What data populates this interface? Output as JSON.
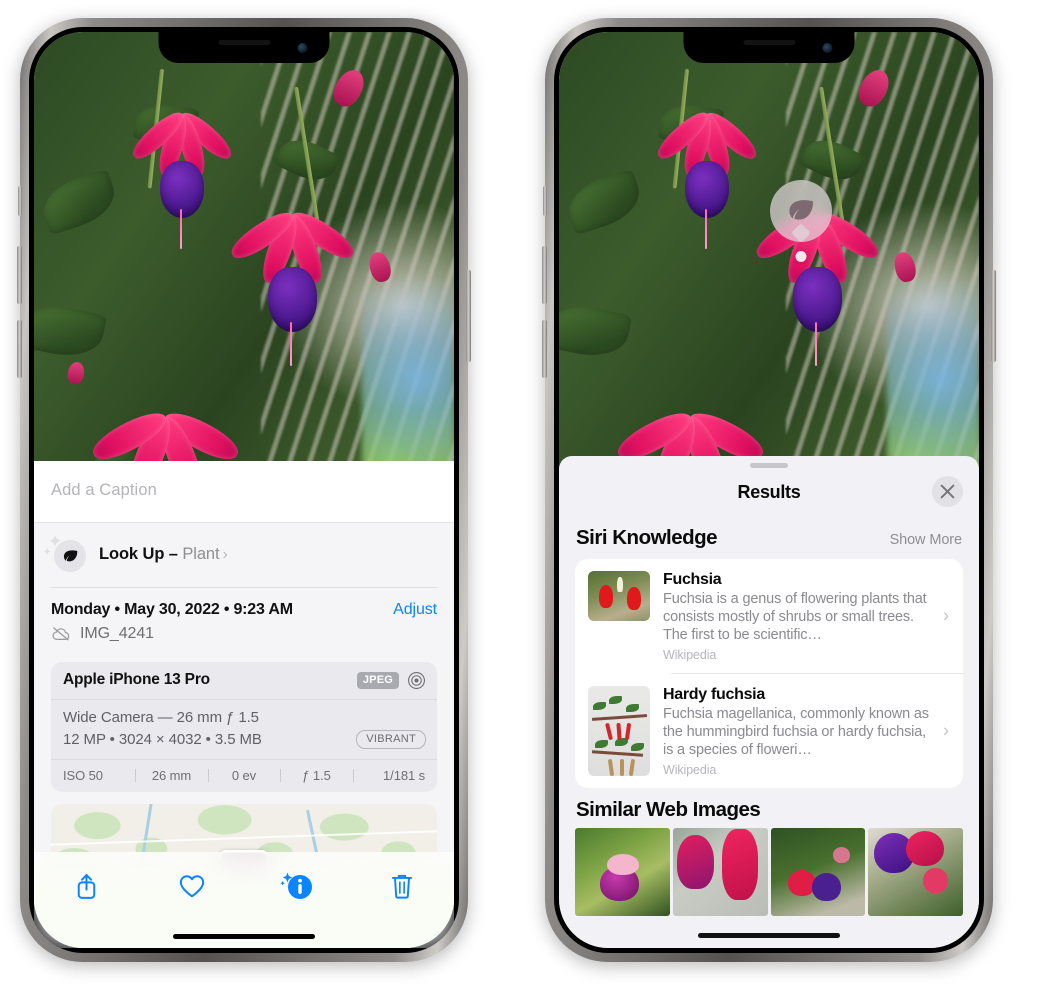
{
  "left_phone": {
    "caption": {
      "placeholder": "Add a Caption",
      "value": ""
    },
    "lookup": {
      "label": "Look Up – ",
      "subject": "Plant",
      "chevron": "›",
      "icon": "leaf-icon"
    },
    "meta": {
      "date": "Monday • May 30, 2022 • 9:23 AM",
      "adjust_label": "Adjust",
      "filename": "IMG_4241",
      "cloud_icon": "icloud-slash-icon"
    },
    "camera_card": {
      "model": "Apple iPhone 13 Pro",
      "format_badge": "JPEG",
      "lens_icon": "aperture-icon",
      "lens": "Wide Camera — 26 mm ƒ 1.5",
      "dimensions": "12 MP • 3024 × 4032 • 3.5 MB",
      "style_badge": "VIBRANT",
      "exif": [
        "ISO 50",
        "26 mm",
        "0 ev",
        "ƒ 1.5",
        "1/181 s"
      ]
    },
    "map": {
      "pin_label": "photo-pin"
    },
    "toolbar": [
      {
        "name": "share-button",
        "icon": "share-icon"
      },
      {
        "name": "favorite-button",
        "icon": "heart-icon"
      },
      {
        "name": "info-button",
        "icon": "info-sparkle-icon"
      },
      {
        "name": "delete-button",
        "icon": "trash-icon"
      }
    ]
  },
  "right_phone": {
    "visual_lookup_badge": {
      "icon": "leaf-icon"
    },
    "sheet": {
      "title": "Results",
      "close_label": "✕",
      "grabber": "drag-handle"
    },
    "siri_knowledge": {
      "heading": "Siri Knowledge",
      "show_more": "Show More",
      "items": [
        {
          "title": "Fuchsia",
          "description": "Fuchsia is a genus of flowering plants that consists mostly of shrubs or small trees. The first to be scientific…",
          "source": "Wikipedia",
          "chevron": "›"
        },
        {
          "title": "Hardy fuchsia",
          "description": "Fuchsia magellanica, commonly known as the hummingbird fuchsia or hardy fuchsia, is a species of floweri…",
          "source": "Wikipedia",
          "chevron": "›"
        }
      ]
    },
    "similar_web_images": {
      "heading": "Similar Web Images",
      "count": 4
    }
  },
  "colors": {
    "accent_blue": "#0a84ff",
    "sheet_bg": "#f2f1f6",
    "info_bg": "#f5f5f7",
    "card_bg": "#eaeaee",
    "secondary_text": "#8e8e93"
  }
}
